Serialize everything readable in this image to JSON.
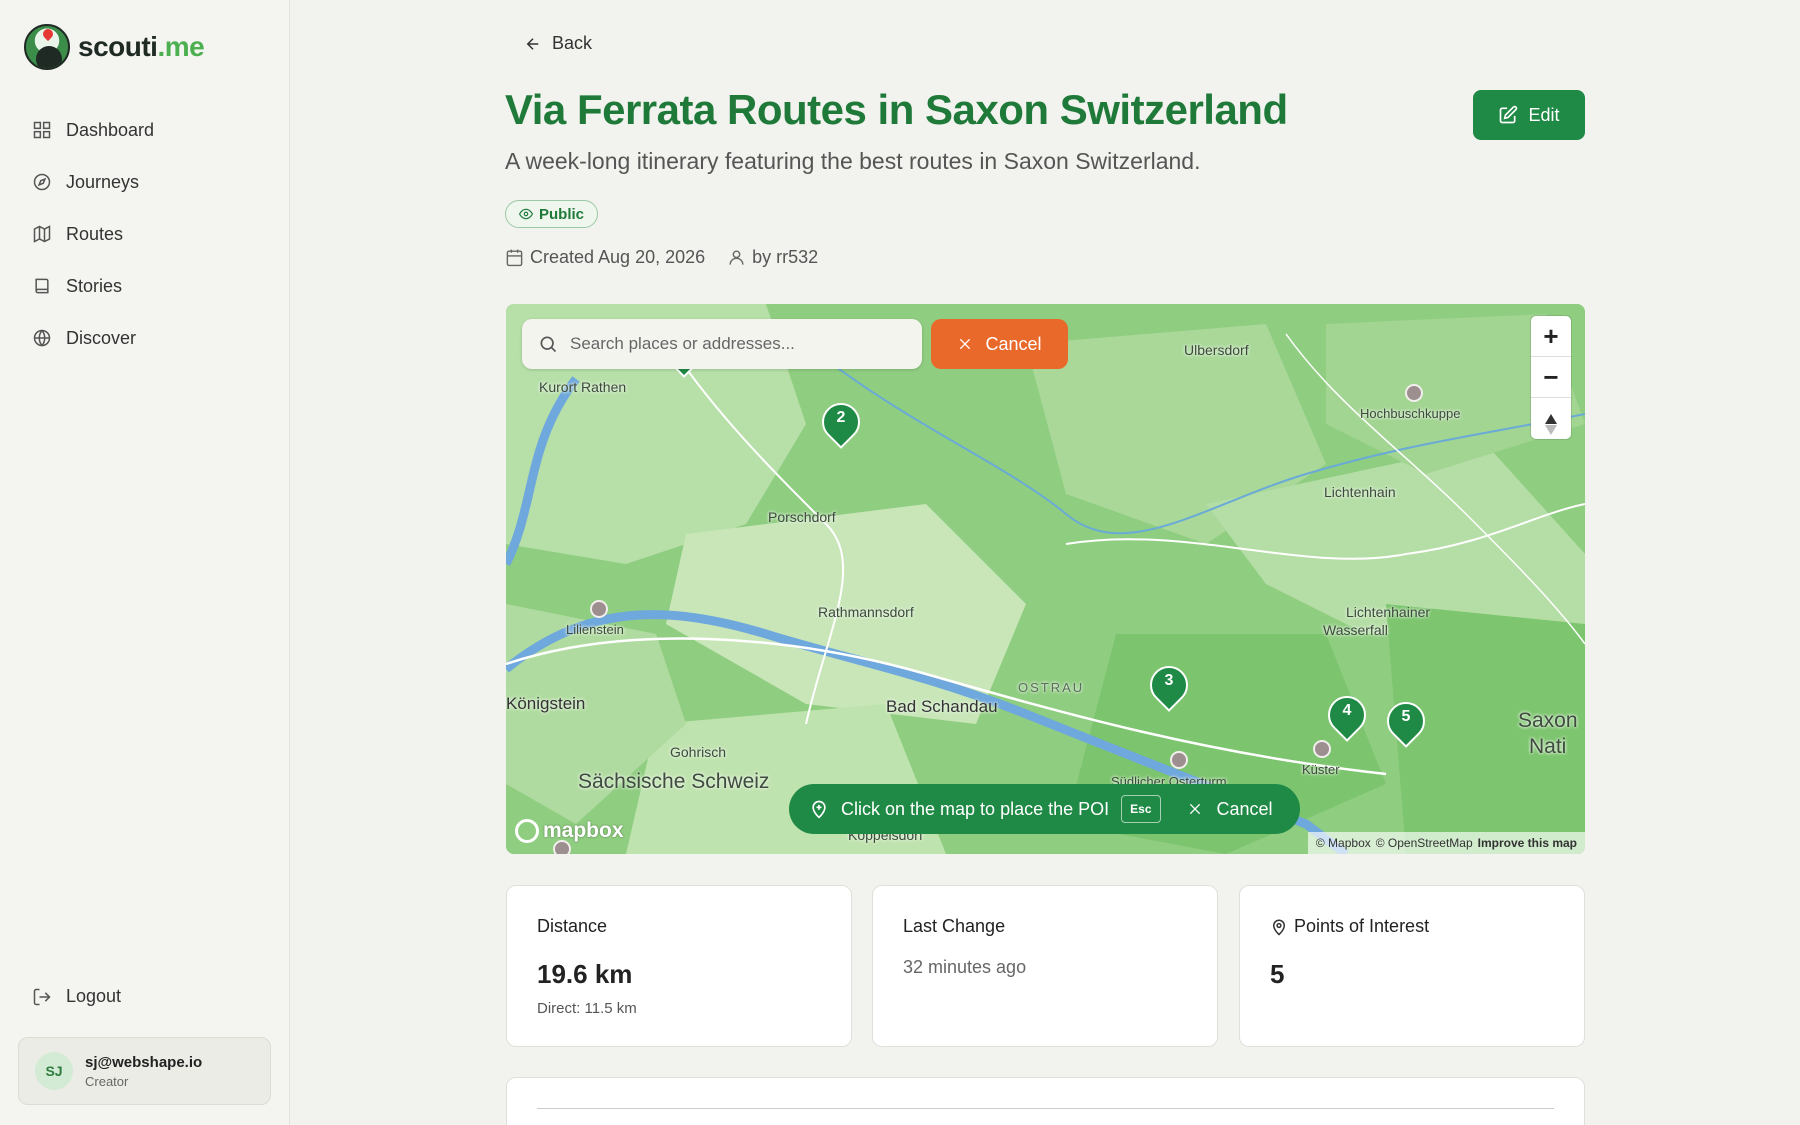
{
  "app": {
    "logo_main": "scouti",
    "logo_accent": ".me"
  },
  "sidebar": {
    "items": [
      {
        "label": "Dashboard",
        "icon": "grid-icon"
      },
      {
        "label": "Journeys",
        "icon": "compass-icon"
      },
      {
        "label": "Routes",
        "icon": "map-icon"
      },
      {
        "label": "Stories",
        "icon": "book-icon"
      },
      {
        "label": "Discover",
        "icon": "globe-icon"
      }
    ],
    "logout_label": "Logout",
    "user": {
      "initials": "SJ",
      "email": "sj@webshape.io",
      "role": "Creator"
    }
  },
  "header": {
    "back_label": "Back",
    "title": "Via Ferrata Routes in Saxon Switzerland",
    "subtitle": "A week-long itinerary featuring the best routes in Saxon Switzerland.",
    "edit_label": "Edit",
    "visibility_badge": "Public",
    "created": "Created Aug 20, 2026",
    "author": "by rr532"
  },
  "map": {
    "search_placeholder": "Search places or addresses...",
    "cancel_label": "Cancel",
    "zoom_in": "+",
    "zoom_out": "−",
    "hint_text": "Click on the map to place the POI",
    "hint_key": "Esc",
    "hint_cancel": "Cancel",
    "mapbox_label": "mapbox",
    "attribution": [
      "© Mapbox",
      "© OpenStreetMap",
      "Improve this map"
    ],
    "places": {
      "kurort_rathen": "Kurort Rathen",
      "ulbersdorf": "Ulbersdorf",
      "hochbuschkuppe": "Hochbuschkuppe",
      "lichtenhain": "Lichtenhain",
      "porschdorf": "Porschdorf",
      "rathmannsdorf": "Rathmannsdorf",
      "lilienstein": "Lilienstein",
      "konigstein": "Königstein",
      "bad_schandau": "Bad Schandau",
      "ostrau": "OSTRAU",
      "lichtenhainer_1": "Lichtenhainer",
      "lichtenhainer_2": "Wasserfall",
      "gohrisch": "Gohrisch",
      "sachsische_schweiz": "Sächsische Schweiz",
      "kuster": "Küster",
      "ostrau_turm": "Südlicher Osterturm",
      "koppelsdorf": "Koppelsdorf",
      "saxon_1": "Saxon",
      "saxon_2": "Nati"
    },
    "markers": [
      "1",
      "2",
      "3",
      "4",
      "5"
    ]
  },
  "stats": {
    "distance": {
      "label": "Distance",
      "value": "19.6 km",
      "sub": "Direct: 11.5 km"
    },
    "last_change": {
      "label": "Last Change",
      "value": "32 minutes ago"
    },
    "poi": {
      "label": "Points of Interest",
      "value": "5"
    }
  },
  "colors": {
    "brand_green": "#1f8a45",
    "title_green": "#1f7a3a",
    "cancel_orange": "#e8692a"
  }
}
